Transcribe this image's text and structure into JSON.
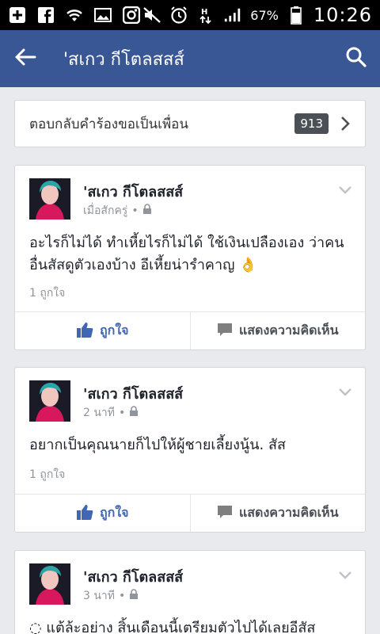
{
  "status_bar": {
    "icons": [
      "add-icon",
      "facebook-icon",
      "wifi-icon",
      "image-icon",
      "instagram-icon",
      "mute-icon",
      "alarm-icon",
      "data-arrows-icon",
      "signal-icon",
      "battery-icon"
    ],
    "battery": "67%",
    "time": "10:26"
  },
  "app_bar": {
    "title": "'สเกว กีโตลสสส์",
    "color": "#3a5795"
  },
  "friend_requests": {
    "label": "ตอบกลับคำร้องขอเป็นเพื่อน",
    "count": "913"
  },
  "posts": [
    {
      "author": "'สเกว กีโตลสสส์",
      "time": "เมื่อสักครู่",
      "text": "อะไรก็ไม่ได้ ทำเหี้ยไรก็ไม่ได้ ใช้เงินเปลืองเอง ว่าคนอื่นสัสดูตัวเองบ้าง อีเหี้ยน่ารำคาญ 👌",
      "likes": "1 ถูกใจ",
      "like_label": "ถูกใจ",
      "comment_label": "แสดงความคิดเห็น"
    },
    {
      "author": "'สเกว กีโตลสสส์",
      "time": "2 นาที",
      "text": "อยากเป็นคุณนายก็ไปให้ผู้ชายเลี้ยงนู้น. สัส",
      "likes": "1 ถูกใจ",
      "like_label": "ถูกใจ",
      "comment_label": "แสดงความคิดเห็น"
    },
    {
      "author": "'สเกว กีโตลสสส์",
      "time": "3 นาที",
      "text": "◌ แต้ล้ะอย่าง สิ้นเดือนนี้เตรียมตัวไปได้เลยอีสัส"
    }
  ]
}
